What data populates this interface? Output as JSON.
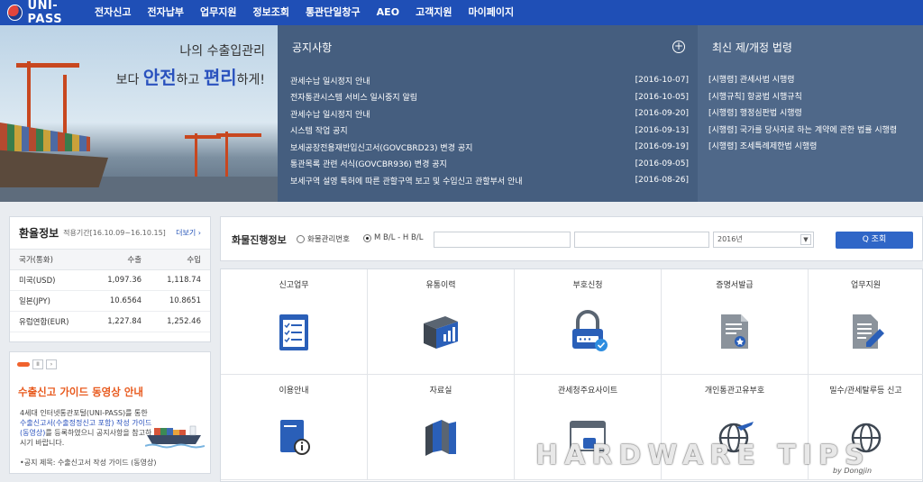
{
  "header": {
    "logo_text": "UNI-PASS",
    "nav": [
      "전자신고",
      "전자납부",
      "업무지원",
      "정보조회",
      "통관단일창구",
      "AEO",
      "고객지원",
      "마이페이지"
    ]
  },
  "hero": {
    "line1": "나의 수출입관리",
    "line2_pre": "보다 ",
    "line2_hl1": "안전",
    "line2_mid": "하고 ",
    "line2_hl2": "편리",
    "line2_post": "하게!"
  },
  "notices": {
    "title": "공지사항",
    "more_symbol": "+",
    "items": [
      {
        "title": "관세수납 일시정지 안내",
        "date": "[2016-10-07]"
      },
      {
        "title": "전자통관시스템 서비스 일시중지 알림",
        "date": "[2016-10-05]"
      },
      {
        "title": "관세수납 일시정지 안내",
        "date": "[2016-09-20]"
      },
      {
        "title": "시스템 작업 공지",
        "date": "[2016-09-13]"
      },
      {
        "title": "보세공장전용재반입신고서(GOVCBRD23) 변경 공지",
        "date": "[2016-09-19]"
      },
      {
        "title": "통관목록 관련 서식(GOVCBR936) 변경 공지",
        "date": "[2016-09-05]"
      },
      {
        "title": "보세구역 설영 특허에 따른 관할구역 보고 및 수입신고 관할부서 안내",
        "date": "[2016-08-26]"
      }
    ]
  },
  "laws": {
    "title": "최신 제/개정 법령",
    "items": [
      "[시행령] 관세사법 시행령",
      "[시행규칙] 항공법 시행규칙",
      "[시행령] 행정심판법 시행령",
      "[시행령] 국가를 당사자로 하는 계약에 관한 법률 시행령",
      "[시행령] 조세특례제한법 시행령"
    ]
  },
  "exchange": {
    "title": "환율정보",
    "period": "적용기간[16.10.09~16.10.15]",
    "more": "더보기 ›",
    "headers": [
      "국가(통화)",
      "수출",
      "수입"
    ],
    "rows": [
      {
        "currency": "미국(USD)",
        "export": "1,097.36",
        "import": "1,118.74"
      },
      {
        "currency": "일본(JPY)",
        "export": "10.6564",
        "import": "10.8651"
      },
      {
        "currency": "유럽연합(EUR)",
        "export": "1,227.84",
        "import": "1,252.46"
      }
    ]
  },
  "guide": {
    "pause_label": "II",
    "next_label": "›",
    "title": "수출신고 가이드 동영상 안내",
    "desc_1": "4세대 인터넷통관포털(UNI-PASS)를 통한 ",
    "desc_link1": "수출신고서(수출정정신고 포함)",
    "desc_2": " ",
    "desc_link2": "작성 가이드(동영상)",
    "desc_3": "를 등록하였으니 공지사항을 참고하시기 바랍니다.",
    "footer": "•공지 제목: 수출신고서 작성 가이드 (동영상)"
  },
  "tracking": {
    "label": "화물진행정보",
    "radio1": "화물관리번호",
    "radio2": "M B/L - H B/L",
    "input_mbl": "",
    "input_hbl": "",
    "year": "2016년",
    "search_label": "Q 조회"
  },
  "services": [
    {
      "label": "신고업무",
      "icon": "checklist-icon",
      "color": "#2a5fb8"
    },
    {
      "label": "유통이력",
      "icon": "books-chart-icon",
      "color": "#2a5fb8"
    },
    {
      "label": "부호신청",
      "icon": "lock-icon",
      "color": "#2a5fb8"
    },
    {
      "label": "증명서발급",
      "icon": "certificate-icon",
      "color": "#6d7580"
    },
    {
      "label": "업무지원",
      "icon": "document-pen-icon",
      "color": "#6d7580"
    },
    {
      "label": "이용안내",
      "icon": "manual-info-icon",
      "color": "#2a5fb8"
    },
    {
      "label": "자료실",
      "icon": "bookshelf-icon",
      "color": "#2a5fb8"
    },
    {
      "label": "관세청주요사이트",
      "icon": "browser-window-icon",
      "color": "#6d7580"
    },
    {
      "label": "개인통관고유부호",
      "icon": "globe-plane-icon",
      "color": "#2a5fb8"
    },
    {
      "label": "밀수/관세탈루등 신고",
      "icon": "globe-icon",
      "color": "#2a5fb8"
    }
  ],
  "watermark": {
    "main": "HARDWARE TIPS",
    "sub": "by Dongjin"
  }
}
